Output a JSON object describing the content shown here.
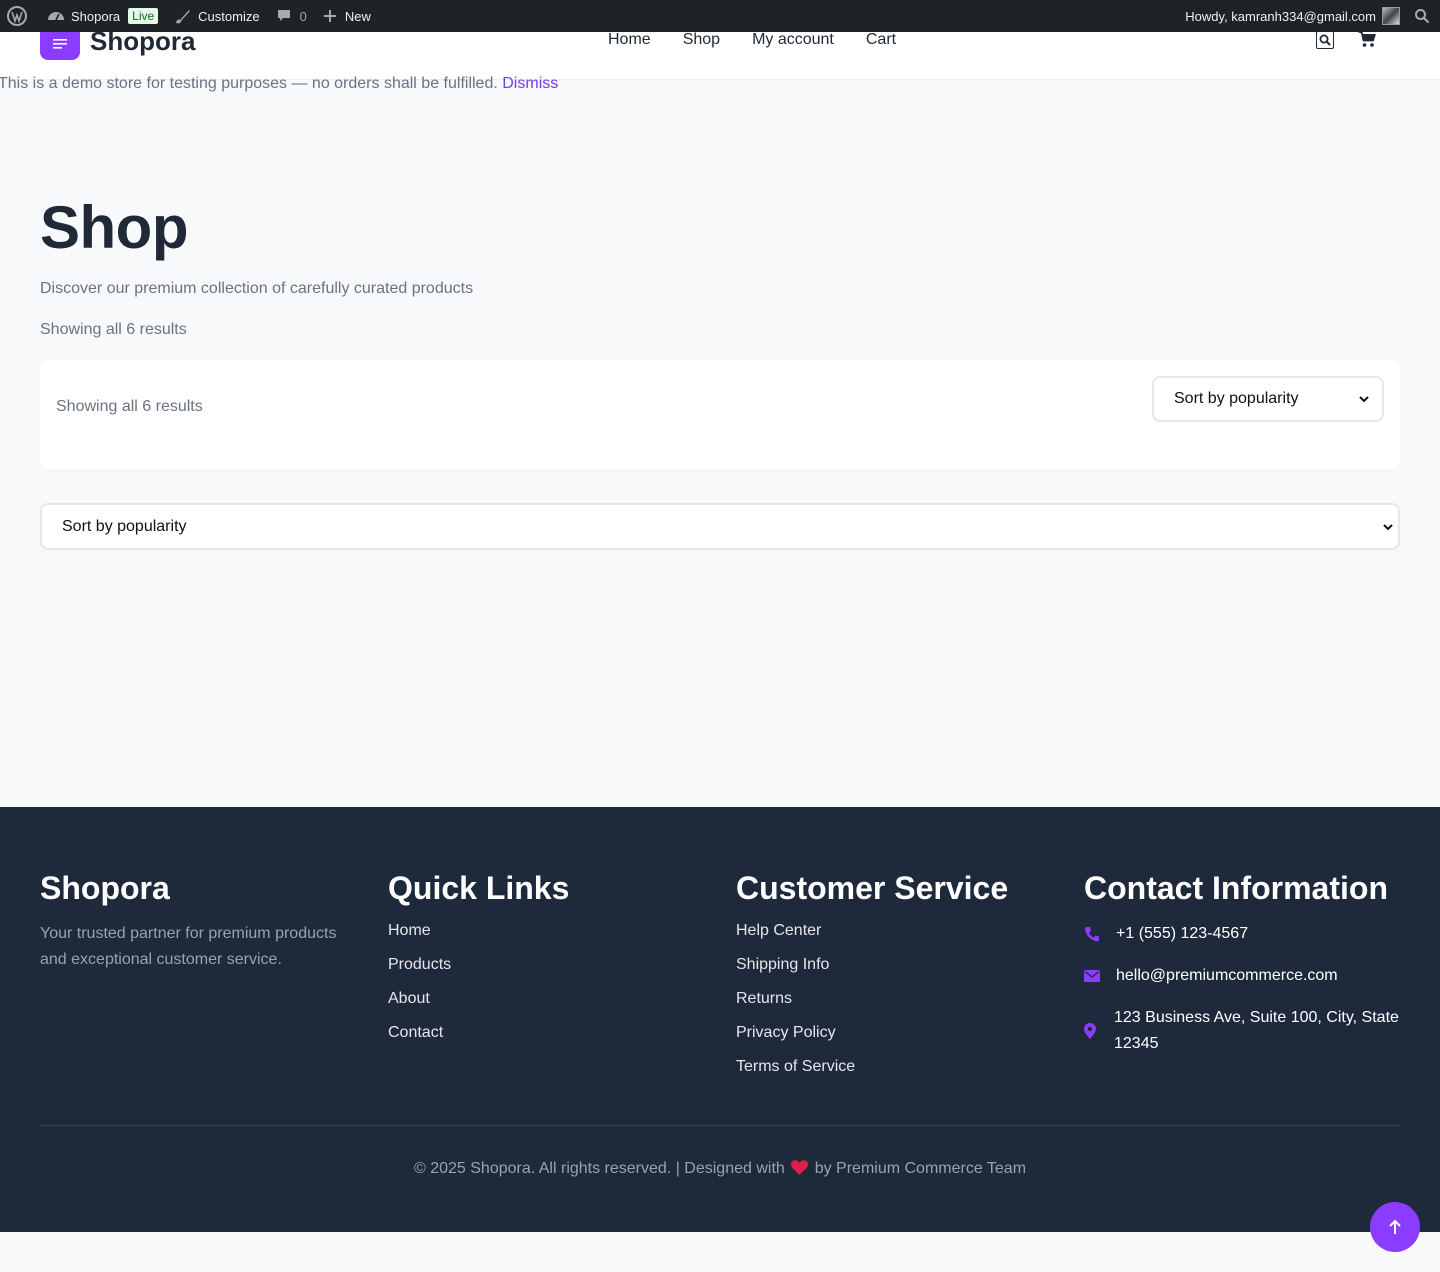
{
  "admin_bar": {
    "site_name": "Shopora",
    "live_badge": "Live",
    "customize": "Customize",
    "comments_count": "0",
    "new_label": "New",
    "howdy": "Howdy, kamranh334@gmail.com"
  },
  "header": {
    "logo_text": "Shopora",
    "nav": [
      "Home",
      "Shop",
      "My account",
      "Cart"
    ]
  },
  "notice": {
    "text": "This is a demo store for testing purposes — no orders shall be fulfilled.",
    "dismiss": "Dismiss"
  },
  "main": {
    "title": "Shop",
    "subtitle": "Discover our premium collection of carefully curated products",
    "result_count": "Showing all 6 results",
    "toolbar_result_count": "Showing all 6 results",
    "sort_selected": "Sort by popularity",
    "sort_selected_full": "Sort by popularity"
  },
  "footer": {
    "brand": {
      "title": "Shopora",
      "description": "Your trusted partner for premium products and exceptional customer service."
    },
    "quick_links": {
      "title": "Quick Links",
      "items": [
        "Home",
        "Products",
        "About",
        "Contact"
      ]
    },
    "customer_service": {
      "title": "Customer Service",
      "items": [
        "Help Center",
        "Shipping Info",
        "Returns",
        "Privacy Policy",
        "Terms of Service"
      ]
    },
    "contact": {
      "title": "Contact Information",
      "phone": "+1 (555) 123-4567",
      "email": "hello@premiumcommerce.com",
      "address": "123 Business Ave, Suite 100, City, State 12345"
    },
    "copyright_left": "© 2025 Shopora. All rights reserved. | Designed with",
    "copyright_right": "by Premium Commerce Team"
  },
  "colors": {
    "accent": "#8b3dff",
    "footer_bg": "#1e293b",
    "admin_bar_bg": "#1d2327"
  },
  "icons": [
    "wordpress-icon",
    "dashboard-icon",
    "brush-icon",
    "comment-icon",
    "plus-icon",
    "search-icon",
    "menu-icon",
    "cart-icon",
    "phone-icon",
    "mail-icon",
    "location-pin-icon",
    "heart-icon",
    "arrow-up-icon"
  ]
}
